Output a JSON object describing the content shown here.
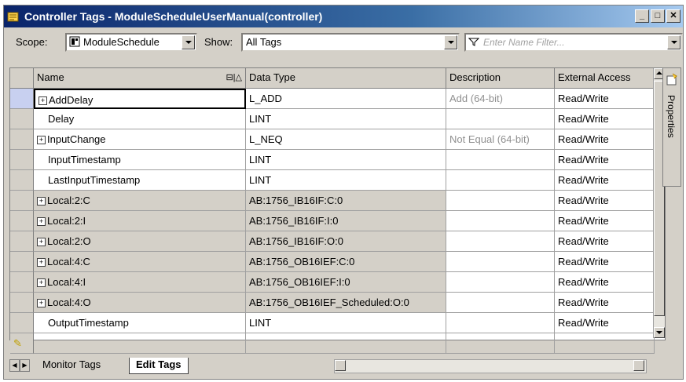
{
  "window": {
    "title": "Controller Tags - ModuleScheduleUserManual(controller)"
  },
  "toolbar": {
    "scope_label": "Scope:",
    "scope_value": "ModuleSchedule",
    "show_label": "Show:",
    "show_value": "All Tags",
    "filter_placeholder": "Enter Name Filter..."
  },
  "columns": {
    "name": "Name",
    "type": "Data Type",
    "desc": "Description",
    "access": "External Access"
  },
  "rows": [
    {
      "name": "AddDelay",
      "type": "L_ADD",
      "desc": "Add (64-bit)",
      "access": "Read/Write",
      "expandable": true,
      "shaded": false
    },
    {
      "name": "Delay",
      "type": "LINT",
      "desc": "",
      "access": "Read/Write",
      "expandable": false,
      "shaded": false
    },
    {
      "name": "InputChange",
      "type": "L_NEQ",
      "desc": "Not Equal (64-bit)",
      "access": "Read/Write",
      "expandable": true,
      "shaded": false
    },
    {
      "name": "InputTimestamp",
      "type": "LINT",
      "desc": "",
      "access": "Read/Write",
      "expandable": false,
      "shaded": false
    },
    {
      "name": "LastInputTimestamp",
      "type": "LINT",
      "desc": "",
      "access": "Read/Write",
      "expandable": false,
      "shaded": false
    },
    {
      "name": "Local:2:C",
      "type": "AB:1756_IB16IF:C:0",
      "desc": "",
      "access": "Read/Write",
      "expandable": true,
      "shaded": true
    },
    {
      "name": "Local:2:I",
      "type": "AB:1756_IB16IF:I:0",
      "desc": "",
      "access": "Read/Write",
      "expandable": true,
      "shaded": true
    },
    {
      "name": "Local:2:O",
      "type": "AB:1756_IB16IF:O:0",
      "desc": "",
      "access": "Read/Write",
      "expandable": true,
      "shaded": true
    },
    {
      "name": "Local:4:C",
      "type": "AB:1756_OB16IEF:C:0",
      "desc": "",
      "access": "Read/Write",
      "expandable": true,
      "shaded": true
    },
    {
      "name": "Local:4:I",
      "type": "AB:1756_OB16IEF:I:0",
      "desc": "",
      "access": "Read/Write",
      "expandable": true,
      "shaded": true
    },
    {
      "name": "Local:4:O",
      "type": "AB:1756_OB16IEF_Scheduled:O:0",
      "desc": "",
      "access": "Read/Write",
      "expandable": true,
      "shaded": true
    },
    {
      "name": "OutputTimestamp",
      "type": "LINT",
      "desc": "",
      "access": "Read/Write",
      "expandable": false,
      "shaded": false
    }
  ],
  "side_panel": {
    "label": "Properties"
  },
  "tabs": [
    {
      "label": "Monitor Tags",
      "active": false
    },
    {
      "label": "Edit Tags",
      "active": true
    }
  ]
}
